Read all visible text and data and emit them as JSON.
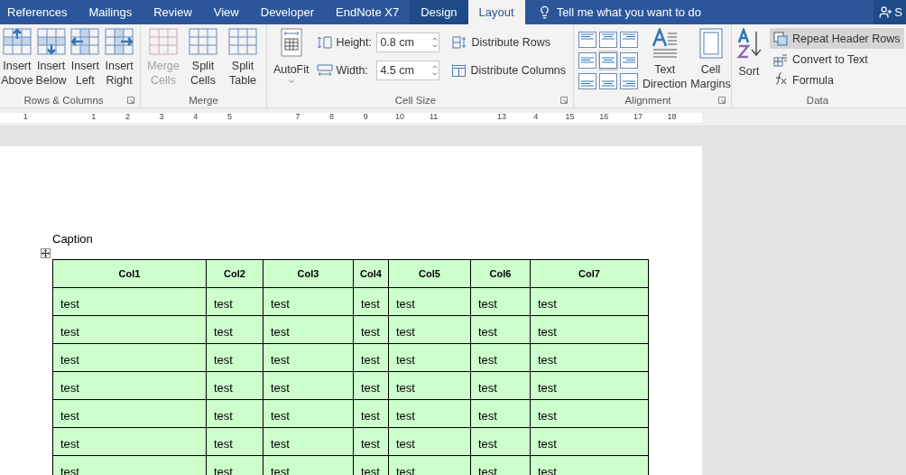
{
  "tabs": [
    {
      "label": "References",
      "selected": false
    },
    {
      "label": "Mailings",
      "selected": false
    },
    {
      "label": "Review",
      "selected": false
    },
    {
      "label": "View",
      "selected": false
    },
    {
      "label": "Developer",
      "selected": false
    },
    {
      "label": "EndNote X7",
      "selected": false
    },
    {
      "label": "Design",
      "selected": false
    },
    {
      "label": "Layout",
      "selected": true
    }
  ],
  "tell_me": {
    "placeholder": "Tell me what you want to do"
  },
  "account": {
    "label": "S"
  },
  "ribbon": {
    "rows_columns": {
      "title": "Rows & Columns",
      "buttons": [
        {
          "kind": "above",
          "label": "Insert Above"
        },
        {
          "kind": "below",
          "label": "Insert Below"
        },
        {
          "kind": "left",
          "label": "Insert Left"
        },
        {
          "kind": "right",
          "label": "Insert Right"
        }
      ]
    },
    "merge": {
      "title": "Merge",
      "buttons": [
        {
          "kind": "merge",
          "label": "Merge Cells",
          "disabled": true
        },
        {
          "kind": "split",
          "label": "Split Cells",
          "disabled": false
        },
        {
          "kind": "splittable",
          "label": "Split Table",
          "disabled": false
        }
      ]
    },
    "autofit": {
      "label": "AutoFit"
    },
    "cell_size": {
      "title": "Cell Size",
      "height": {
        "label": "Height:",
        "value": "0.8 cm"
      },
      "width": {
        "label": "Width:",
        "value": "4.5 cm"
      },
      "distribute": [
        {
          "kind": "rows",
          "label": "Distribute Rows"
        },
        {
          "kind": "cols",
          "label": "Distribute Columns"
        }
      ]
    },
    "alignment": {
      "title": "Alignment",
      "cells": [
        {
          "selected": false
        },
        {
          "selected": false
        },
        {
          "selected": false
        },
        {
          "selected": false
        },
        {
          "selected": true
        },
        {
          "selected": false
        },
        {
          "selected": false
        },
        {
          "selected": false
        },
        {
          "selected": false
        }
      ],
      "buttons": [
        {
          "kind": "direction",
          "label": "Text Direction"
        },
        {
          "kind": "margins",
          "label": "Cell Margins"
        }
      ]
    },
    "data": {
      "title": "Data",
      "sort": "Sort",
      "items": [
        {
          "kind": "repeat",
          "label": "Repeat Header Rows",
          "selected": true
        },
        {
          "kind": "convert",
          "label": "Convert to Text",
          "selected": false
        },
        {
          "kind": "formula",
          "label": "Formula",
          "selected": false
        }
      ]
    }
  },
  "ruler": [
    "1",
    "1",
    "2",
    "3",
    "4",
    "5",
    "7",
    "8",
    "9",
    "10",
    "11",
    "13",
    "4",
    "15",
    "16",
    "17",
    "18"
  ],
  "document": {
    "caption": "Caption",
    "table": {
      "columns": [
        "Col1",
        "Col2",
        "Col3",
        "Col4",
        "Col5",
        "Col6",
        "Col7"
      ],
      "rows": [
        [
          "test",
          "test",
          "test",
          "test",
          "test",
          "test",
          "test"
        ],
        [
          "test",
          "test",
          "test",
          "test",
          "test",
          "test",
          "test"
        ],
        [
          "test",
          "test",
          "test",
          "test",
          "test",
          "test",
          "test"
        ],
        [
          "test",
          "test",
          "test",
          "test",
          "test",
          "test",
          "test"
        ],
        [
          "test",
          "test",
          "test",
          "test",
          "test",
          "test",
          "test"
        ],
        [
          "test",
          "test",
          "test",
          "test",
          "test",
          "test",
          "test"
        ],
        [
          "test",
          "test",
          "test",
          "test",
          "test",
          "test",
          "test"
        ]
      ]
    }
  }
}
